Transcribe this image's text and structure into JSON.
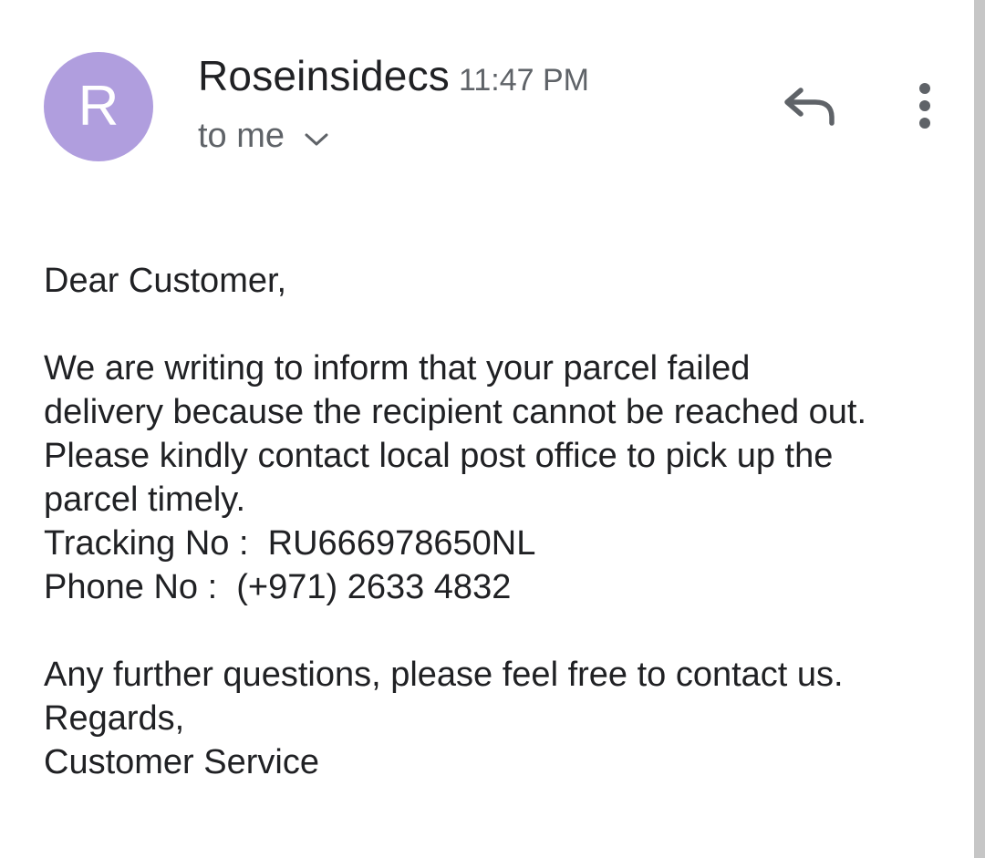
{
  "header": {
    "avatar_letter": "R",
    "avatar_color": "#b09ede",
    "sender_name": "Roseinsidecs",
    "timestamp": "11:47 PM",
    "recipient_label": "to me",
    "expand_icon": "chevron-down-icon",
    "reply_icon": "reply-icon",
    "more_icon": "more-vert-icon"
  },
  "body": {
    "greeting": "Dear Customer,",
    "paragraph_lines": [
      "We are writing to inform that your parcel failed",
      "delivery because the recipient cannot be reached out.",
      "Please kindly contact local post office to pick up the",
      "parcel timely."
    ],
    "tracking_line": "Tracking No :  RU666978650NL",
    "phone_line": "Phone No :  (+971) 2633 4832",
    "closing_line": "Any further questions, please feel free to contact us.",
    "regards": "Regards,",
    "signature": "Customer Service"
  }
}
